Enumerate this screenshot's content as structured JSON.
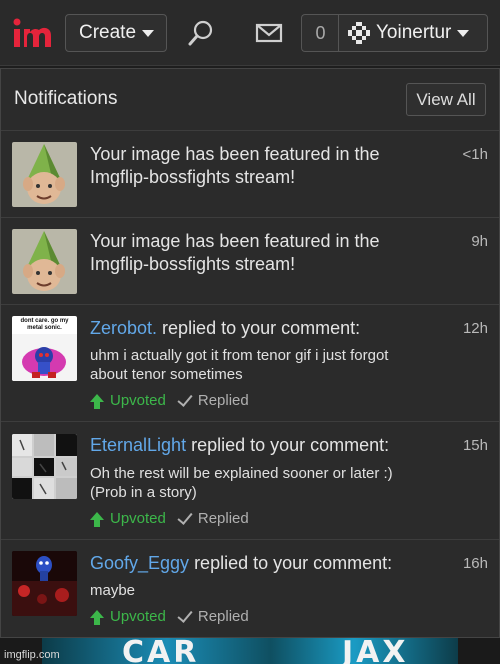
{
  "header": {
    "logo_text": "im",
    "create_label": "Create",
    "count": "0",
    "username": "Yoinertur",
    "icons": [
      "search-icon",
      "mail-icon",
      "user-avatar-icon"
    ]
  },
  "notifications_panel": {
    "title": "Notifications",
    "view_all_label": "View All",
    "items": [
      {
        "type": "featured",
        "text_line1": "Your image has been featured in the",
        "text_line2": "Imgflip-bossfights stream!",
        "time": "<1h",
        "thumb": "gnome"
      },
      {
        "type": "featured",
        "text_line1": "Your image has been featured in the",
        "text_line2": "Imgflip-bossfights stream!",
        "time": "9h",
        "thumb": "gnome"
      },
      {
        "type": "reply",
        "user": "Zerobot.",
        "action": " replied to your comment:",
        "body_line1": "uhm i actually got it from tenor gif i just forgot",
        "body_line2": "about tenor sometimes",
        "upvoted_label": "Upvoted",
        "replied_label": "Replied",
        "time": "12h",
        "thumb_caption": "dont care. go my metal sonic."
      },
      {
        "type": "reply",
        "user": "EternalLight",
        "action": " replied to your comment:",
        "body_line1": "Oh the rest will be explained sooner or later :)",
        "body_line2": "(Prob in a story)",
        "upvoted_label": "Upvoted",
        "replied_label": "Replied",
        "time": "15h"
      },
      {
        "type": "reply",
        "user": "Goofy_Eggy",
        "action": " replied to your comment:",
        "body_line1": "maybe",
        "upvoted_label": "Upvoted",
        "replied_label": "Replied",
        "time": "16h"
      }
    ]
  },
  "banner": {
    "left_text": "CAR",
    "right_text": "JAX"
  },
  "watermark": "imgflip.com",
  "colors": {
    "link": "#62a8e9",
    "upvote": "#3cb74a",
    "logo_red": "#e5243b",
    "background": "#2b2b2b"
  }
}
